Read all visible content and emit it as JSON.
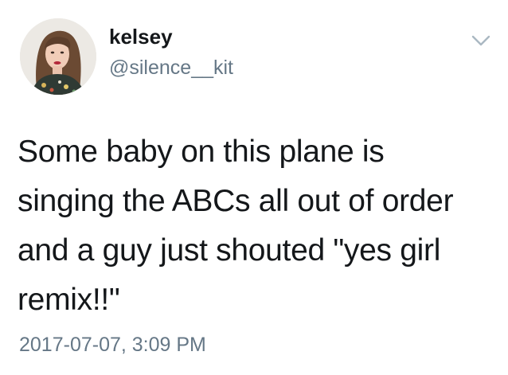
{
  "user": {
    "display_name": "kelsey",
    "handle": "@silence__kit"
  },
  "tweet": {
    "lines": [
      "Some baby on this plane is",
      "singing the ABCs all out of order",
      "and a guy just shouted \"yes girl",
      "remix!!\""
    ],
    "timestamp": "2017-07-07, 3:09 PM"
  },
  "icons": {
    "avatar": "user-avatar-photo",
    "menu": "chevron-down-icon"
  },
  "colors": {
    "text": "#14171a",
    "secondary": "#657786",
    "caret": "#aab8c2"
  }
}
